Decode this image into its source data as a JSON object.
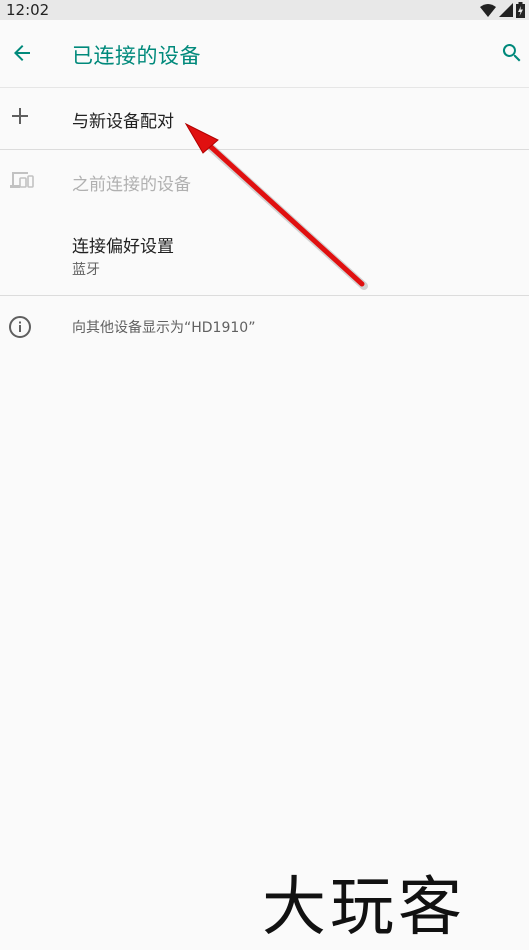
{
  "status_bar": {
    "time": "12:02",
    "icons": [
      "wifi-icon",
      "cell-signal-icon",
      "battery-charging-icon"
    ]
  },
  "app_bar": {
    "back_icon": "arrow-left-icon",
    "title": "已连接的设备",
    "search_icon": "search-icon"
  },
  "list": {
    "pair_new": {
      "icon": "plus-icon",
      "label": "与新设备配对"
    },
    "previous": {
      "icon": "devices-icon",
      "label": "之前连接的设备"
    },
    "preferences": {
      "label": "连接偏好设置",
      "summary": "蓝牙"
    },
    "visible_as": {
      "icon": "info-icon",
      "label": "向其他设备显示为“HD1910”"
    }
  },
  "watermark": {
    "text": "大玩客"
  },
  "colors": {
    "accent": "#00897b",
    "annotation_arrow": "#e01010"
  }
}
